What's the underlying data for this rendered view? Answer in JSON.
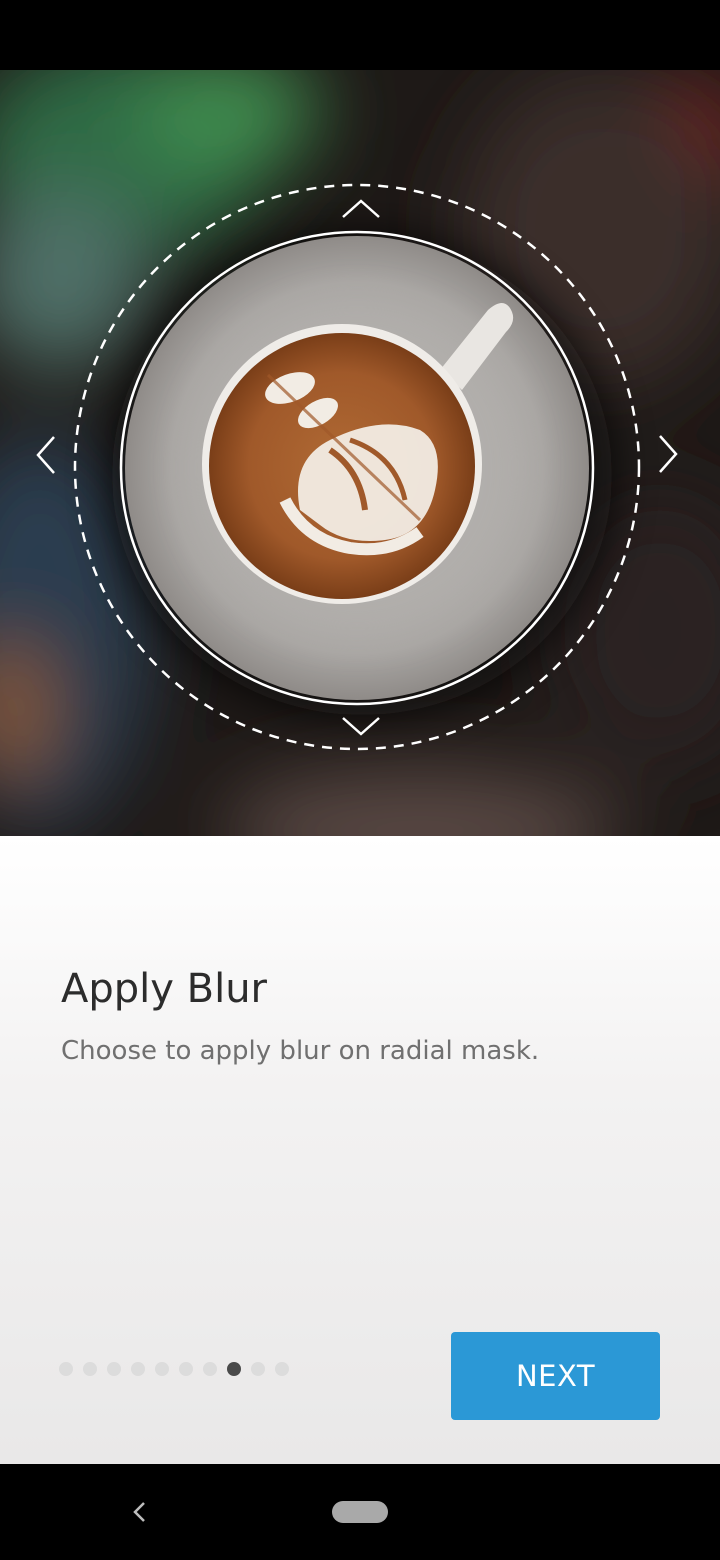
{
  "hero": {
    "image": "latte-art-coffee-cup-on-saucer",
    "mask_controls": [
      "chevron-up-icon",
      "chevron-down-icon",
      "chevron-left-icon",
      "chevron-right-icon"
    ]
  },
  "content": {
    "title": "Apply Blur",
    "subtitle": "Choose to apply blur on radial mask."
  },
  "pager": {
    "total": 10,
    "active_index": 7
  },
  "next_button": {
    "label": "NEXT"
  },
  "colors": {
    "accent": "#2b98d6",
    "active_dot": "#4a4a4a",
    "inactive_dot": "#dcdcdc"
  },
  "nav": {
    "back_icon": "back-chevron-icon",
    "home_icon": "home-pill-icon"
  }
}
